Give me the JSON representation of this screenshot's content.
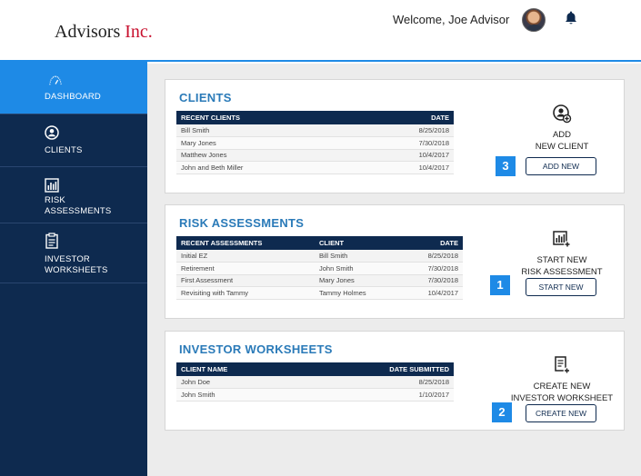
{
  "header": {
    "brand_main": "Advisors ",
    "brand_accent": "Inc.",
    "welcome": "Welcome, Joe Advisor"
  },
  "sidebar": {
    "items": [
      {
        "label_1": "DASHBOARD",
        "label_2": "",
        "icon": "gauge-icon",
        "active": true
      },
      {
        "label_1": "CLIENTS",
        "label_2": "",
        "icon": "user-circle-icon"
      },
      {
        "label_1": "RISK",
        "label_2": "ASSESSMENTS",
        "icon": "bar-chart-icon"
      },
      {
        "label_1": "INVESTOR",
        "label_2": "WORKSHEETS",
        "icon": "clipboard-icon"
      }
    ]
  },
  "clients": {
    "title": "CLIENTS",
    "columns": [
      "RECENT CLIENTS",
      "DATE"
    ],
    "rows": [
      [
        "Bill Smith",
        "8/25/2018"
      ],
      [
        "Mary Jones",
        "7/30/2018"
      ],
      [
        "Matthew Jones",
        "10/4/2017"
      ],
      [
        "John and Beth Miller",
        "10/4/2017"
      ]
    ],
    "action_line1": "ADD",
    "action_line2": "NEW CLIENT",
    "button": "ADD NEW",
    "badge": "3",
    "icon": "add-user-icon"
  },
  "risk": {
    "title": "RISK ASSESSMENTS",
    "columns": [
      "RECENT ASSESSMENTS",
      "CLIENT",
      "DATE"
    ],
    "rows": [
      [
        "Initial EZ",
        "Bill Smith",
        "8/25/2018"
      ],
      [
        "Retirement",
        "John Smith",
        "7/30/2018"
      ],
      [
        "First Assessment",
        "Mary Jones",
        "7/30/2018"
      ],
      [
        "Revisiting with Tammy",
        "Tammy Holmes",
        "10/4/2017"
      ]
    ],
    "action_line1": "START NEW",
    "action_line2": "RISK ASSESSMENT",
    "button": "START NEW",
    "badge": "1",
    "icon": "add-chart-icon"
  },
  "worksheets": {
    "title": "INVESTOR WORKSHEETS",
    "columns": [
      "CLIENT NAME",
      "DATE SUBMITTED"
    ],
    "rows": [
      [
        "John Doe",
        "8/25/2018"
      ],
      [
        "John Smith",
        "1/10/2017"
      ]
    ],
    "action_line1": "CREATE NEW",
    "action_line2": "INVESTOR WORKSHEET",
    "button": "CREATE NEW",
    "badge": "2",
    "icon": "add-document-icon"
  },
  "colors": {
    "accent_blue": "#1e8ae6",
    "navy": "#0e2a4f",
    "title_blue": "#2a7ab8",
    "brand_red": "#c8102e"
  }
}
